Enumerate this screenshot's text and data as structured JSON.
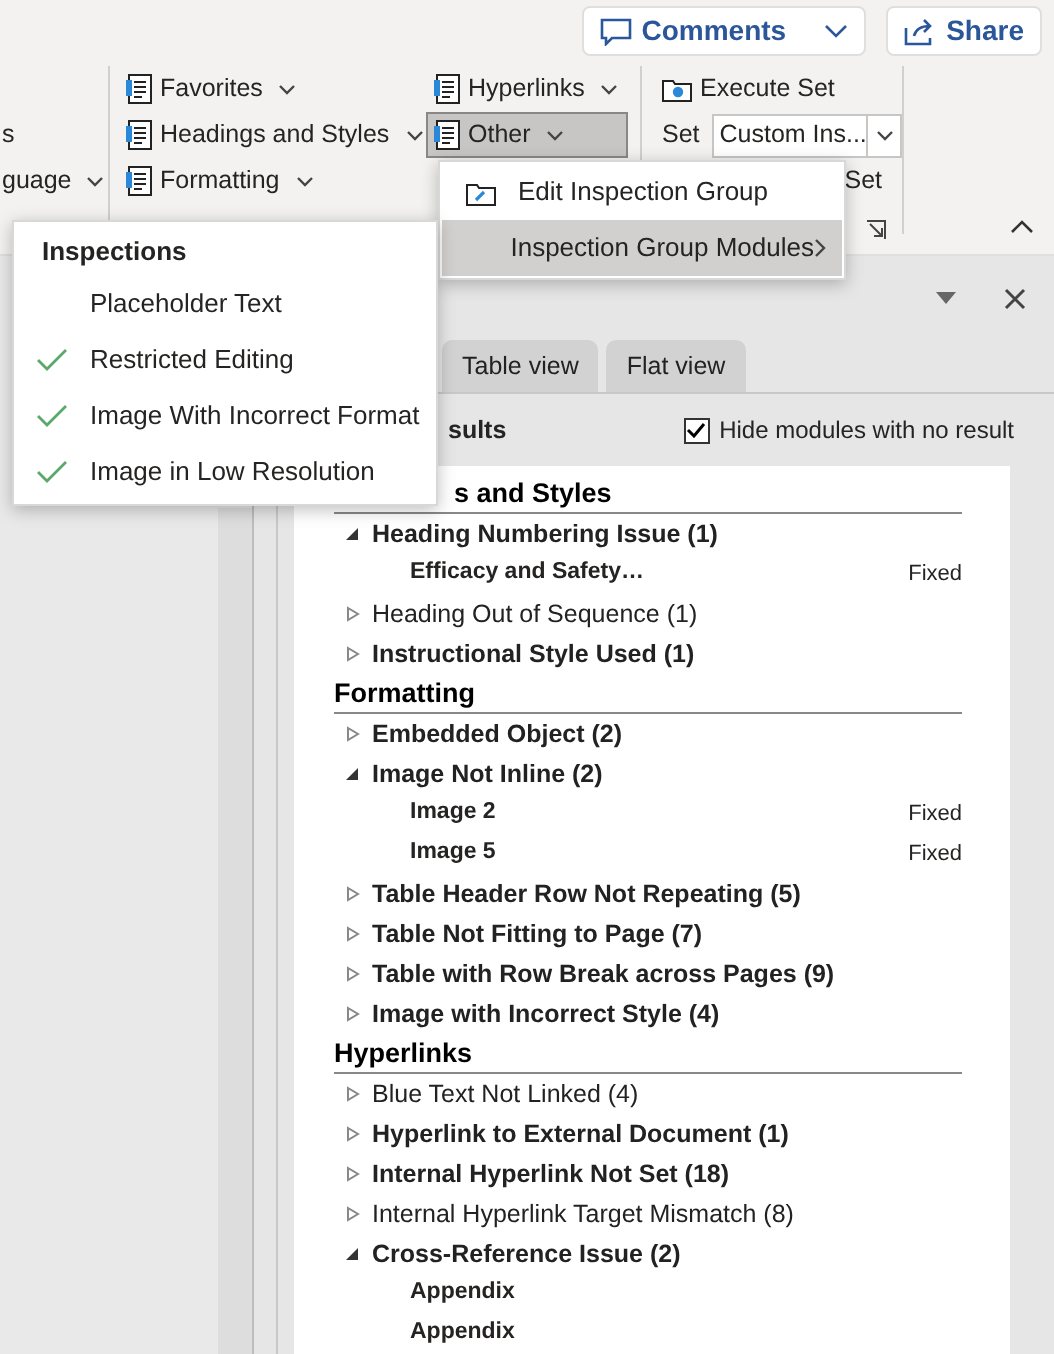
{
  "ribbon": {
    "top_buttons": [
      {
        "label": "Comments",
        "kind": "comments"
      },
      {
        "label": "Share",
        "kind": "share"
      }
    ],
    "left_edge": [
      {
        "label": "s",
        "dropdown": false
      },
      {
        "label": "guage",
        "dropdown": true
      }
    ],
    "first_column": [
      {
        "label": "Favorites"
      },
      {
        "label": "Headings and Styles"
      },
      {
        "label": "Formatting"
      }
    ],
    "second_column": [
      {
        "label": "Hyperlinks",
        "pressed": false
      },
      {
        "label": "Other",
        "pressed": true
      }
    ],
    "execute": {
      "label": "Execute Set"
    },
    "set": {
      "label": "Set",
      "value": "Custom Ins..."
    },
    "fragment": "Set"
  },
  "other_menu": [
    {
      "label": "Edit Inspection Group",
      "kind": "command",
      "selected": false
    },
    {
      "label": "Inspection Group Modules",
      "kind": "submenu",
      "selected": true
    }
  ],
  "inspections_menu": {
    "title": "Inspections",
    "items": [
      {
        "label": "Placeholder Text",
        "checked": false
      },
      {
        "label": "Restricted Editing",
        "checked": true
      },
      {
        "label": "Image With Incorrect Format",
        "checked": true
      },
      {
        "label": "Image in Low Resolution",
        "checked": true
      }
    ]
  },
  "panel": {
    "tabs": [
      {
        "label": "Table view",
        "selected": false
      },
      {
        "label": "Flat view",
        "selected": false
      }
    ],
    "results_label": "sults",
    "hide_checkbox": {
      "label": "Hide modules with no result",
      "checked": true
    },
    "groups": [
      {
        "title": "s and Styles",
        "partly_hidden": true,
        "items": [
          {
            "label": "Heading Numbering Issue (1)",
            "bold": true,
            "expanded": true,
            "children": [
              {
                "label": "Efficacy and Safety…",
                "status": "Fixed"
              }
            ]
          },
          {
            "label": "Heading Out of Sequence (1)",
            "bold": false,
            "expanded": false
          },
          {
            "label": "Instructional Style Used (1)",
            "bold": true,
            "expanded": false
          }
        ]
      },
      {
        "title": "Formatting",
        "partly_hidden": false,
        "items": [
          {
            "label": "Embedded Object (2)",
            "bold": true,
            "expanded": false
          },
          {
            "label": "Image Not Inline (2)",
            "bold": true,
            "expanded": true,
            "children": [
              {
                "label": "Image 2",
                "status": "Fixed"
              },
              {
                "label": "Image 5",
                "status": "Fixed"
              }
            ]
          },
          {
            "label": "Table Header Row Not Repeating (5)",
            "bold": true,
            "expanded": false
          },
          {
            "label": "Table Not Fitting to Page (7)",
            "bold": true,
            "expanded": false
          },
          {
            "label": "Table with Row Break across Pages (9)",
            "bold": true,
            "expanded": false
          },
          {
            "label": "Image with Incorrect Style (4)",
            "bold": true,
            "expanded": false
          }
        ]
      },
      {
        "title": "Hyperlinks",
        "partly_hidden": false,
        "items": [
          {
            "label": "Blue Text Not Linked (4)",
            "bold": false,
            "expanded": false
          },
          {
            "label": "Hyperlink to External Document (1)",
            "bold": true,
            "expanded": false
          },
          {
            "label": "Internal Hyperlink Not Set (18)",
            "bold": true,
            "expanded": false
          },
          {
            "label": "Internal Hyperlink Target Mismatch (8)",
            "bold": false,
            "expanded": false
          },
          {
            "label": "Cross-Reference Issue (2)",
            "bold": true,
            "expanded": true,
            "children": [
              {
                "label": "Appendix"
              },
              {
                "label": "Appendix"
              }
            ]
          }
        ]
      }
    ]
  }
}
